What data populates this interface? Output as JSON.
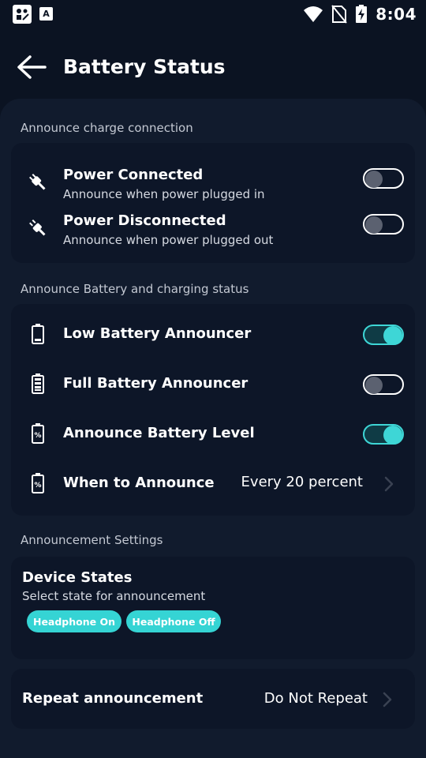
{
  "status_bar": {
    "time": "8:04",
    "icons": [
      "app-notification-icon",
      "font-app-icon",
      "wifi-icon",
      "no-sim-icon",
      "battery-charging-icon"
    ],
    "app2_glyph": "A"
  },
  "header": {
    "title": "Battery Status",
    "back_icon": "arrow-left-icon"
  },
  "sections": {
    "charge_connection": {
      "label": "Announce charge connection",
      "items": [
        {
          "title": "Power Connected",
          "subtitle": "Announce when power plugged in",
          "icon": "plug-connected-icon",
          "enabled": false
        },
        {
          "title": "Power Disconnected",
          "subtitle": "Announce when power plugged out",
          "icon": "plug-disconnected-icon",
          "enabled": false
        }
      ]
    },
    "battery_status": {
      "label": "Announce Battery and charging status",
      "items": [
        {
          "title": "Low Battery Announcer",
          "icon": "battery-low-icon",
          "enabled": true
        },
        {
          "title": "Full Battery Announcer",
          "icon": "battery-full-icon",
          "enabled": false
        },
        {
          "title": "Announce Battery Level",
          "icon": "battery-percent-icon",
          "enabled": true
        }
      ],
      "when": {
        "title": "When to Announce",
        "value": "Every 20 percent",
        "icon": "battery-percent-icon"
      }
    },
    "announcement_settings": {
      "label": "Announcement Settings",
      "device_states": {
        "title": "Device States",
        "subtitle": "Select state for announcement",
        "chips": [
          "Headphone On",
          "Headphone Off"
        ]
      },
      "repeat": {
        "title": "Repeat announcement",
        "value": "Do Not Repeat"
      }
    }
  },
  "colors": {
    "background": "#0b1322",
    "panel": "#111b2d",
    "card": "#0d1628",
    "accent": "#3ed6d6",
    "toggle_off_knob": "#5b6170"
  }
}
